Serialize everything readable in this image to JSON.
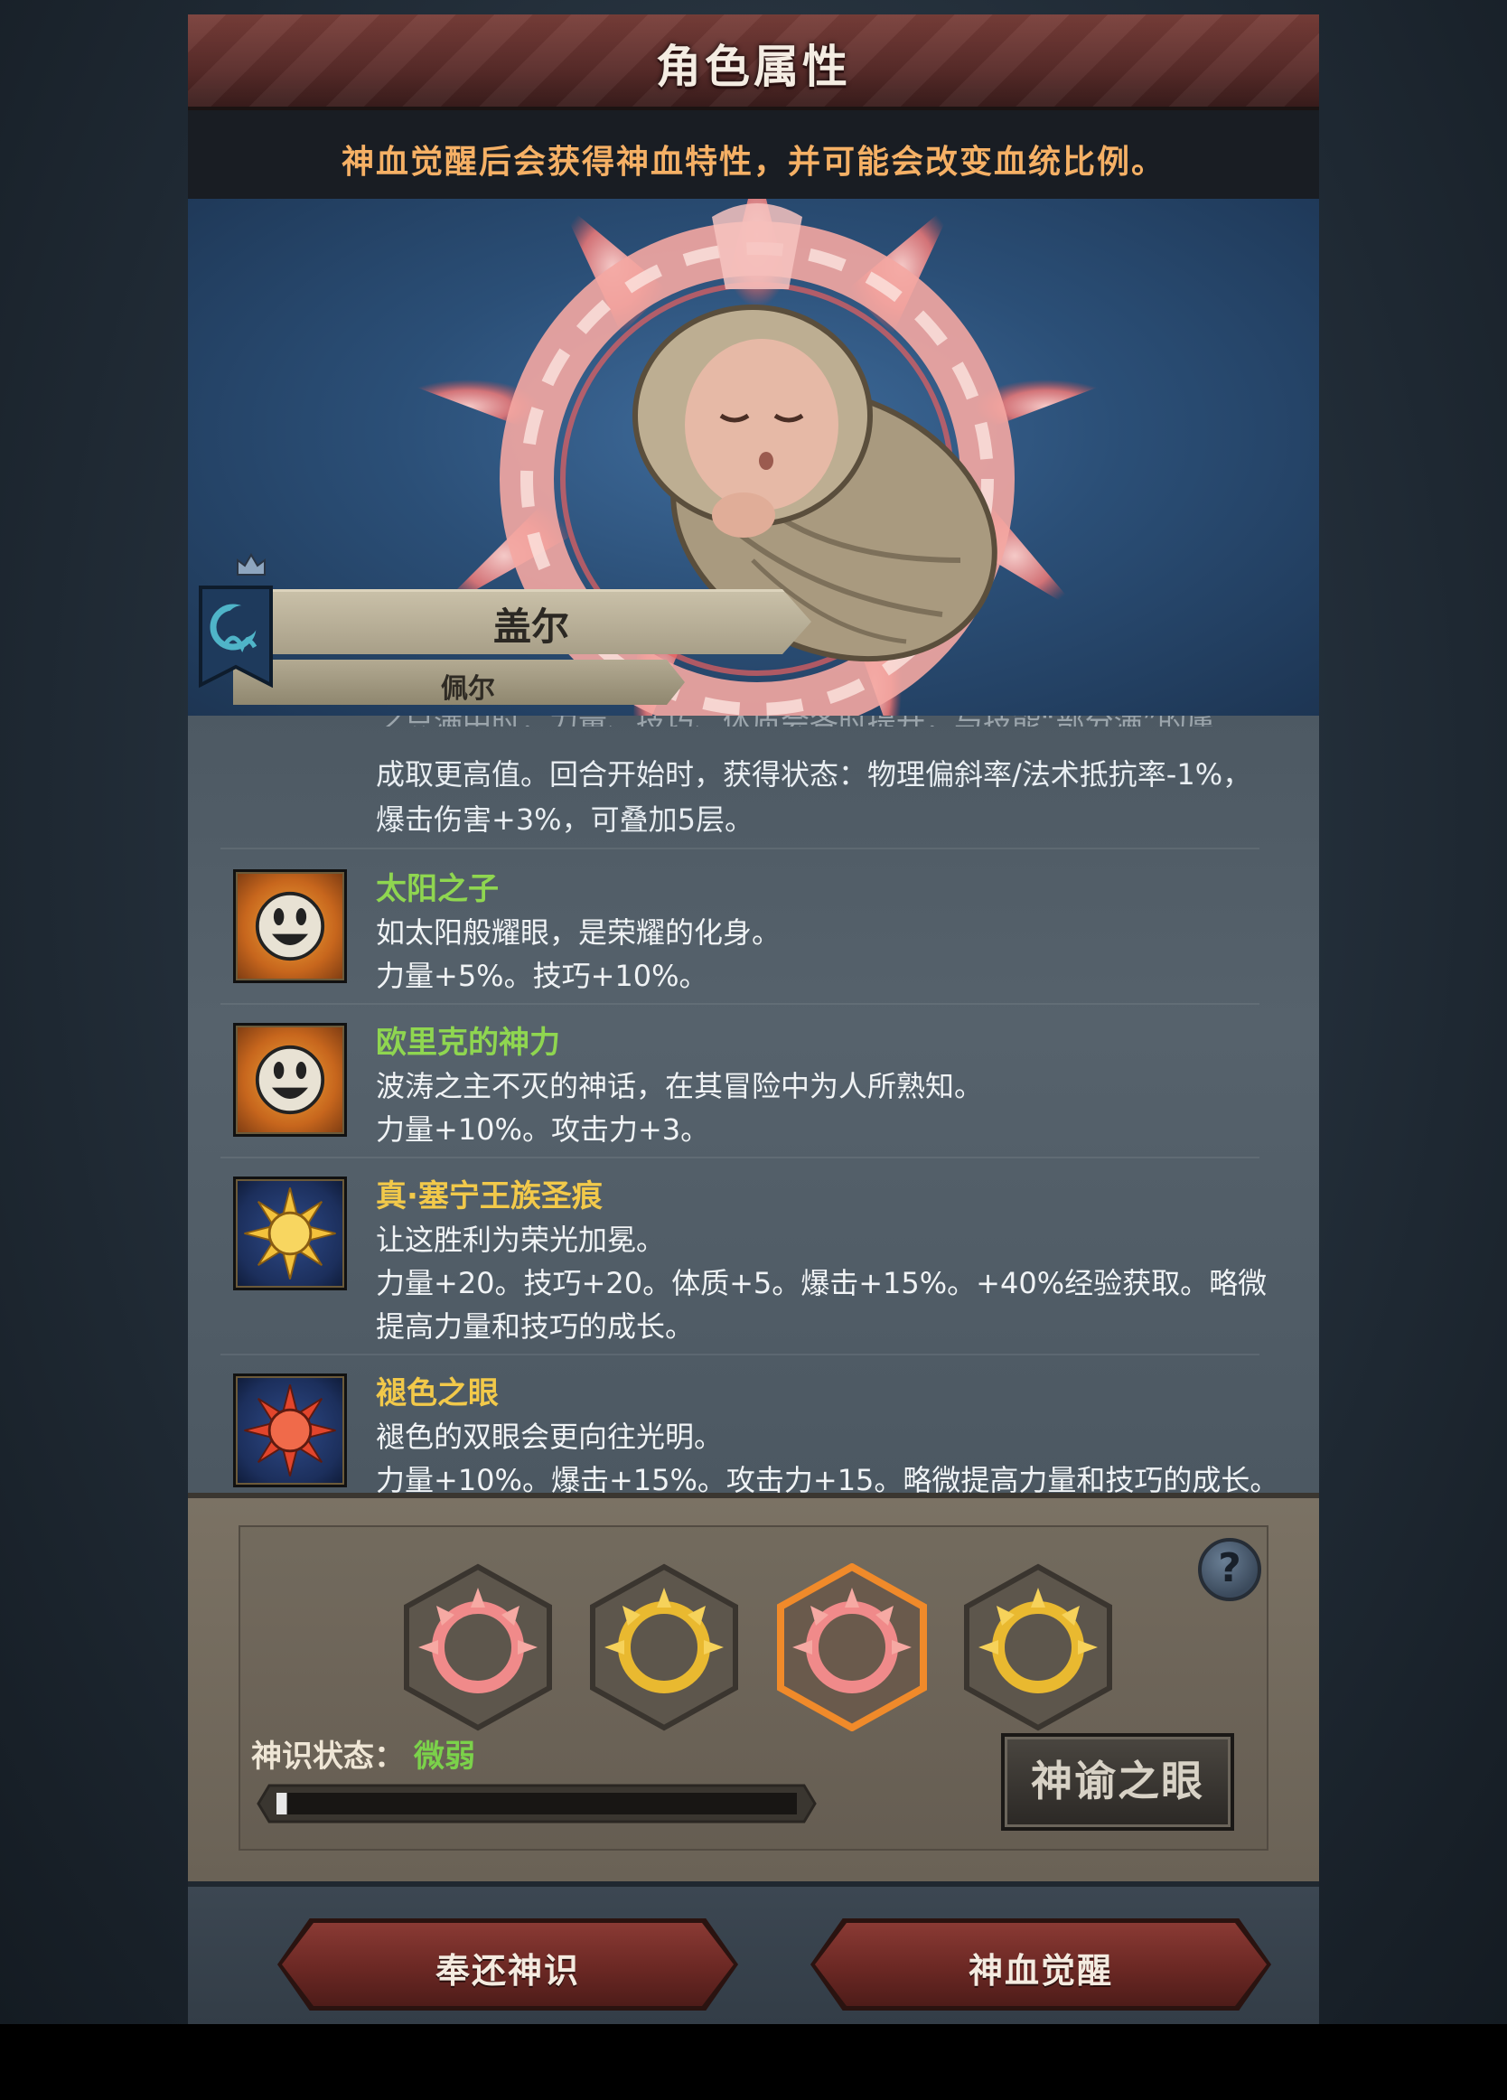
{
  "header": {
    "title": "角色属性"
  },
  "notice": {
    "text": "神血觉醒后会获得神血特性，并可能会改变血统比例。"
  },
  "hero": {
    "name": "盖尔",
    "alt_name": "佩尔"
  },
  "trait_list": {
    "clipped_top_line": "之只满中时，力量、技巧、体质会各时提升，与技能“部分满”的属",
    "continued_desc": [
      "成取更高值。回合开始时，获得状态：物理偏斜率/法术抵抗率-1%，",
      "爆击伤害+3%，可叠加5层。"
    ],
    "items": [
      {
        "icon": "smiling-sun-icon",
        "name": "太阳之子",
        "name_color": "#8fd650",
        "lines": [
          "如太阳般耀眼，是荣耀的化身。",
          "力量+5%。技巧+10%。"
        ]
      },
      {
        "icon": "smiling-sun-icon",
        "name": "欧里克的神力",
        "name_color": "#8fd650",
        "lines": [
          "波涛之主不灭的神话，在其冒险中为人所熟知。",
          "力量+10%。攻击力+3。"
        ]
      },
      {
        "icon": "golden-sun-seal-icon",
        "name": "真·塞宁王族圣痕",
        "name_color": "#f2c94a",
        "lines": [
          "让这胜利为荣光加冕。",
          "力量+20。技巧+20。体质+5。爆击+15%。+40%经验获取。略微",
          "提高力量和技巧的成长。"
        ]
      },
      {
        "icon": "red-sun-seal-icon",
        "name": "褪色之眼",
        "name_color": "#f2c94a",
        "lines": [
          "褪色的双眼会更向往光明。",
          "力量+10%。爆击+15%。攻击力+15。略微提高力量和技巧的成长。"
        ]
      }
    ]
  },
  "awaken": {
    "status_label": "神识状态：",
    "status_value": "微弱",
    "oracle_button": "神谕之眼",
    "help_symbol": "?",
    "progress_fraction": 0.02,
    "seals": [
      {
        "color": "pink",
        "selected": false
      },
      {
        "color": "gold",
        "selected": false
      },
      {
        "color": "pink",
        "selected": true
      },
      {
        "color": "gold",
        "selected": false
      }
    ]
  },
  "footer": {
    "return_button": "奉还神识",
    "awaken_button": "神血觉醒"
  },
  "colors": {
    "accent_gold": "#f5b065",
    "trait_green": "#8fd650",
    "trait_gold": "#f2c94a",
    "status_green": "#7bd24a",
    "button_red": "#6b2824"
  }
}
